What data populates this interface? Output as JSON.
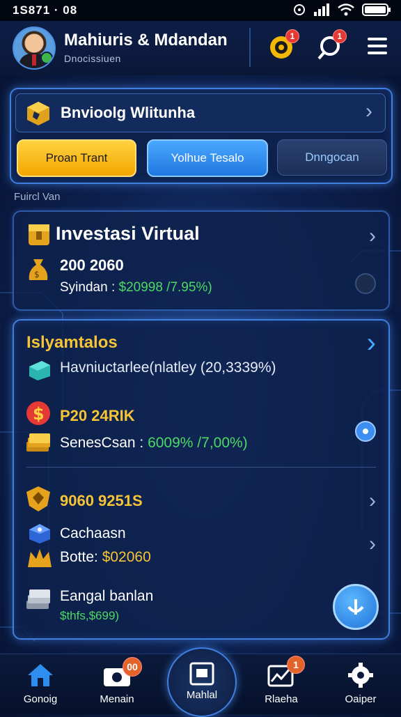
{
  "status_bar": {
    "time": "1S871 · 08"
  },
  "header": {
    "title": "Mahiuris & Mdandan",
    "subtitle": "Dnocissiuen",
    "notif_badge_1": "1",
    "notif_badge_2": "1"
  },
  "top_card": {
    "title": "Bnvioolg Wlitunha",
    "buttons": [
      "Proan Trant",
      "Yolhue Tesalo",
      "Dnngocan"
    ]
  },
  "section_label": "Fuircl Van",
  "investasi_card": {
    "title": "Investasi Virtual",
    "amount": "200 2060",
    "sub_label": "Syindan : ",
    "sub_value": "$20998 /7.95%)"
  },
  "list_card": {
    "title": "Islyamtalos",
    "row1": "Havniuctarlee(nlatley (20,3339%)",
    "row2_amount": "P20 24RIK",
    "row2_label": "SenesCsan : ",
    "row2_value": "6009% /7,00%)",
    "row3_amount": "9060 9251S",
    "row4_label": "Cachaasn",
    "row5_label": "Botte: ",
    "row5_value": "$02060",
    "row6_label": "Eangal banlan",
    "row6_value": "$thfs,$699)"
  },
  "nav": {
    "items": [
      "Gonoig",
      "Menain",
      "Mahlal",
      "Rlaeha",
      "Oaiper"
    ],
    "badge_menain": "00",
    "badge_rlaeha": "1"
  },
  "colors": {
    "accent": "#3f7fe0",
    "green": "#4cd964",
    "gold": "#f7c437",
    "primary_btn": "#f5b400",
    "blue_btn": "#2e8ef0"
  }
}
